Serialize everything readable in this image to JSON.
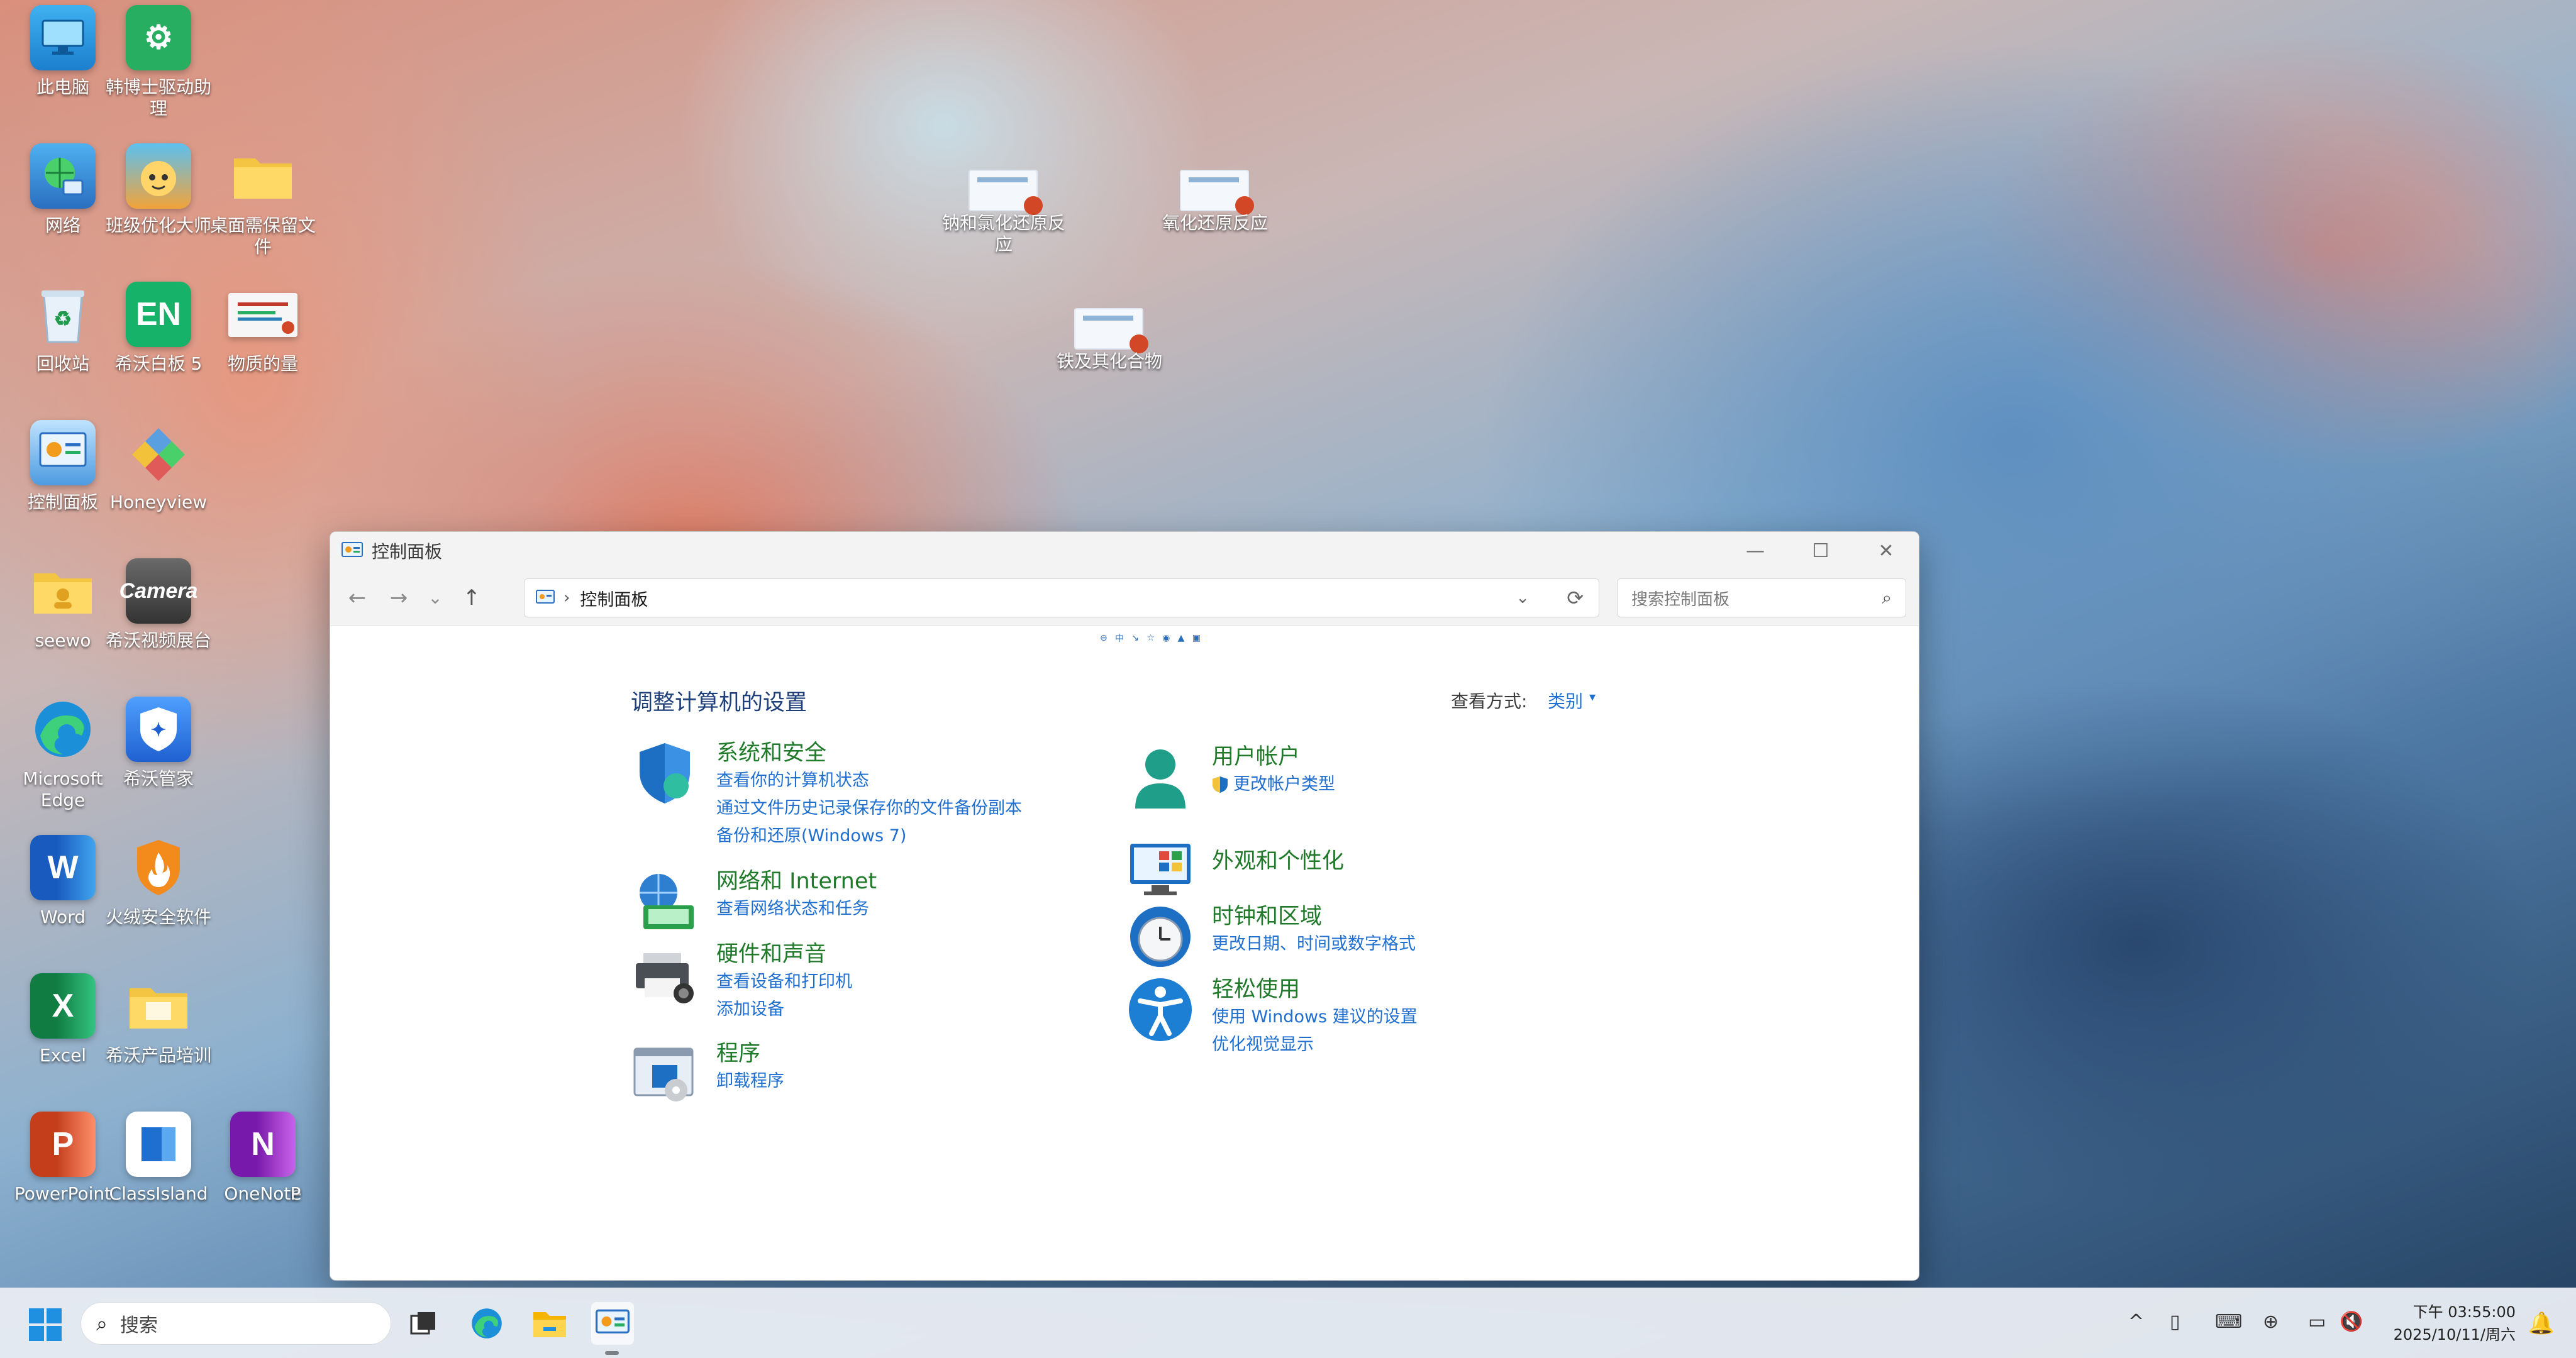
{
  "desktop": {
    "icons": [
      {
        "label": "此电脑",
        "icon": "computer-icon",
        "color": "#1f9ae0"
      },
      {
        "label": "韩博士驱动助理",
        "icon": "gear-icon",
        "color": "#27ae60"
      },
      {
        "label": "网络",
        "icon": "network-globe-icon",
        "color": "#2f7fd0"
      },
      {
        "label": "班级优化大师",
        "icon": "mascot-icon",
        "color": "#f2a33a"
      },
      {
        "label": "桌面需保留文件",
        "icon": "folder-icon",
        "color": "#f4c542"
      },
      {
        "label": "回收站",
        "icon": "recycle-bin-icon",
        "color": "#9db7cf"
      },
      {
        "label": "希沃白板 5",
        "icon": "en-board-icon",
        "color": "#17b26a"
      },
      {
        "label": "物质的量",
        "icon": "ppt-thumb-icon",
        "color": "#d24726"
      },
      {
        "label": "控制面板",
        "icon": "control-panel-icon",
        "color": "#2f7fd0"
      },
      {
        "label": "Honeyview",
        "icon": "honeyview-icon",
        "color": "#5aa0e0"
      },
      {
        "label": "seewo",
        "icon": "seewo-folder-icon",
        "color": "#f4c542"
      },
      {
        "label": "希沃视频展台",
        "icon": "camera-icon",
        "color": "#4a4a4a"
      },
      {
        "label": "Microsoft Edge",
        "icon": "edge-icon",
        "color": "#1b8fd8"
      },
      {
        "label": "希沃管家",
        "icon": "shield-icon",
        "color": "#2f7fe0"
      },
      {
        "label": "Word",
        "icon": "word-icon",
        "color": "#2b579a"
      },
      {
        "label": "火绒安全软件",
        "icon": "flame-shield-icon",
        "color": "#f28a1c"
      },
      {
        "label": "Excel",
        "icon": "excel-icon",
        "color": "#217346"
      },
      {
        "label": "希沃产品培训",
        "icon": "folder-icon",
        "color": "#f4c542"
      },
      {
        "label": "PowerPoint",
        "icon": "powerpoint-icon",
        "color": "#d24726"
      },
      {
        "label": "ClassIsland",
        "icon": "classisland-icon",
        "color": "#1f6fd0"
      },
      {
        "label": "OneNote",
        "icon": "onenote-icon",
        "color": "#7719aa"
      },
      {
        "label": "P",
        "icon": "partial-icon",
        "color": "#888888"
      }
    ],
    "files": [
      {
        "label": "钠和氯化还原反应",
        "icon": "ppt-file-icon"
      },
      {
        "label": "氧化还原反应",
        "icon": "ppt-file-icon"
      },
      {
        "label": "铁及其化合物",
        "icon": "ppt-file-icon"
      }
    ]
  },
  "window": {
    "title": "控制面板",
    "controls": {
      "minimize": "—",
      "maximize": "☐",
      "close": "✕"
    },
    "nav": {
      "back": "←",
      "forward": "→",
      "recent": "⌄",
      "up": "↑"
    },
    "address": {
      "separator": "›",
      "path": "控制面板",
      "dropdown": "⌄",
      "refresh": "⟳"
    },
    "search": {
      "placeholder": "搜索控制面板",
      "icon": "⌕"
    },
    "heading": "调整计算机的设置",
    "view_by": {
      "label": "查看方式:",
      "value": "类别",
      "caret": "▾"
    },
    "categories_left": [
      {
        "title": "系统和安全",
        "icon": "security-shield-icon",
        "links": [
          "查看你的计算机状态",
          "通过文件历史记录保存你的文件备份副本",
          "备份和还原(Windows 7)"
        ]
      },
      {
        "title": "网络和 Internet",
        "icon": "network-internet-icon",
        "links": [
          "查看网络状态和任务"
        ]
      },
      {
        "title": "硬件和声音",
        "icon": "printer-icon",
        "links": [
          "查看设备和打印机",
          "添加设备"
        ]
      },
      {
        "title": "程序",
        "icon": "programs-icon",
        "links": [
          "卸载程序"
        ]
      }
    ],
    "categories_right": [
      {
        "title": "用户帐户",
        "icon": "user-account-icon",
        "links": [
          "更改帐户类型"
        ]
      },
      {
        "title": "外观和个性化",
        "icon": "appearance-icon",
        "links": []
      },
      {
        "title": "时钟和区域",
        "icon": "clock-region-icon",
        "links": [
          "更改日期、时间或数字格式"
        ]
      },
      {
        "title": "轻松使用",
        "icon": "accessibility-icon",
        "links": [
          "使用 Windows 建议的设置",
          "优化视觉显示"
        ]
      }
    ]
  },
  "taskbar": {
    "search_label": "搜索",
    "search_icon": "⌕",
    "apps": [
      "task-view-icon",
      "edge-icon",
      "file-explorer-icon",
      "control-panel-icon"
    ],
    "tray": {
      "chevron": "^",
      "volume_muted": "🔇"
    },
    "clock": {
      "time": "下午 03:55:00",
      "date": "2025/10/11/周六"
    },
    "notification": "🔔"
  }
}
